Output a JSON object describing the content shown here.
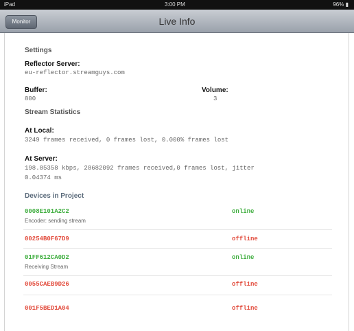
{
  "status_bar": {
    "left": "iPad",
    "time": "3:00 PM",
    "right": "96% ▮"
  },
  "nav": {
    "back_label": "Monitor",
    "title": "Live Info"
  },
  "settings": {
    "heading": "Settings",
    "reflector_label": "Reflector Server:",
    "reflector_value": "eu-reflector.streamguys.com",
    "buffer_label": "Buffer:",
    "buffer_value": "800",
    "volume_label": "Volume:",
    "volume_value": "3"
  },
  "stream_stats": {
    "heading": "Stream Statistics",
    "at_local_label": "At Local:",
    "at_local_value": "3249 frames received, 0 frames lost, 0.000% frames lost",
    "at_server_label": "At Server:",
    "at_server_line1": "198.85358 kbps, 28682092 frames received,0 frames lost, jitter",
    "at_server_line2": "0.04374 ms"
  },
  "devices": {
    "heading": "Devices in Project",
    "items": [
      {
        "id": "0008E101A2C2",
        "status": "online",
        "detail": "Encoder: sending stream"
      },
      {
        "id": "00254B0F67D9",
        "status": "offline",
        "detail": ""
      },
      {
        "id": "01FF612CA0D2",
        "status": "online",
        "detail": "Receiving Stream"
      },
      {
        "id": "0055CAEB9D26",
        "status": "offline",
        "detail": ""
      },
      {
        "id": "001F5BED1A04",
        "status": "offline",
        "detail": ""
      }
    ]
  },
  "colors": {
    "online": "#3fae3f",
    "offline": "#e24b3c",
    "nav_bar": "#9aa1ab"
  }
}
